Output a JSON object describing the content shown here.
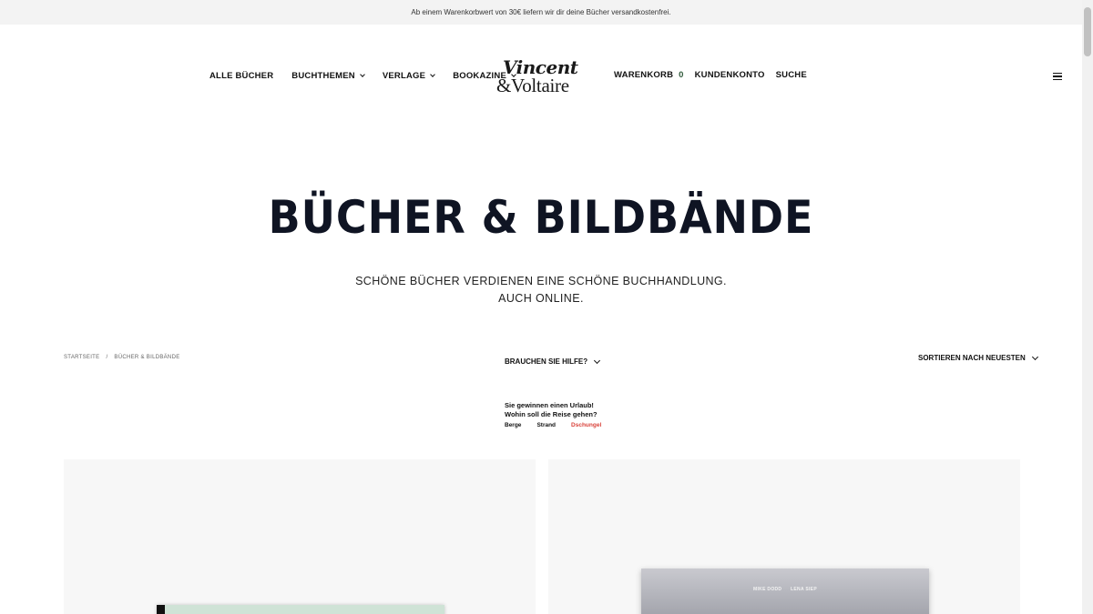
{
  "announcement": "Ab einem Warenkorbwert von 30€ liefern wir dir deine Bücher versandkostenfrei.",
  "nav_left": [
    {
      "label": "ALLE BÜCHER",
      "dropdown": false
    },
    {
      "label": "BUCHTHEMEN",
      "dropdown": true
    },
    {
      "label": "VERLAGE",
      "dropdown": true
    },
    {
      "label": "BOOKAZINE",
      "dropdown": true
    }
  ],
  "logo": {
    "line1": "Vincent",
    "line2": "&Voltaire"
  },
  "nav_right": {
    "cart_label": "WARENKORB",
    "cart_count": "0",
    "account_label": "KUNDENKONTO",
    "search_label": "SUCHE"
  },
  "hero": {
    "title": "BÜCHER & BILDBÄNDE",
    "subtitle_line1": "SCHÖNE BÜCHER VERDIENEN EINE SCHÖNE BUCHHANDLUNG.",
    "subtitle_line2": "AUCH ONLINE."
  },
  "breadcrumb": {
    "home": "STARTSEITE",
    "separator": "/",
    "current": "BÜCHER & BILDBÄNDE"
  },
  "help_label": "BRAUCHEN SIE HILFE?",
  "sort_label": "SORTIEREN NACH NEUESTEN",
  "quiz": {
    "line1": "Sie gewinnen einen Urlaub!",
    "line2": "Wohin soll die Reise gehen?",
    "options": [
      "Berge",
      "Strand",
      "Dschungel"
    ],
    "active_option": "Dschungel"
  },
  "products": [
    {
      "cover_text": []
    },
    {
      "cover_text": [
        "MIKE DODD",
        "LENA SIEP"
      ]
    }
  ],
  "colors": {
    "accent_red": "#d9423a",
    "cart_count": "#2f5a3a",
    "title": "#0f1423",
    "topbar_bg": "#f3f3f3"
  }
}
